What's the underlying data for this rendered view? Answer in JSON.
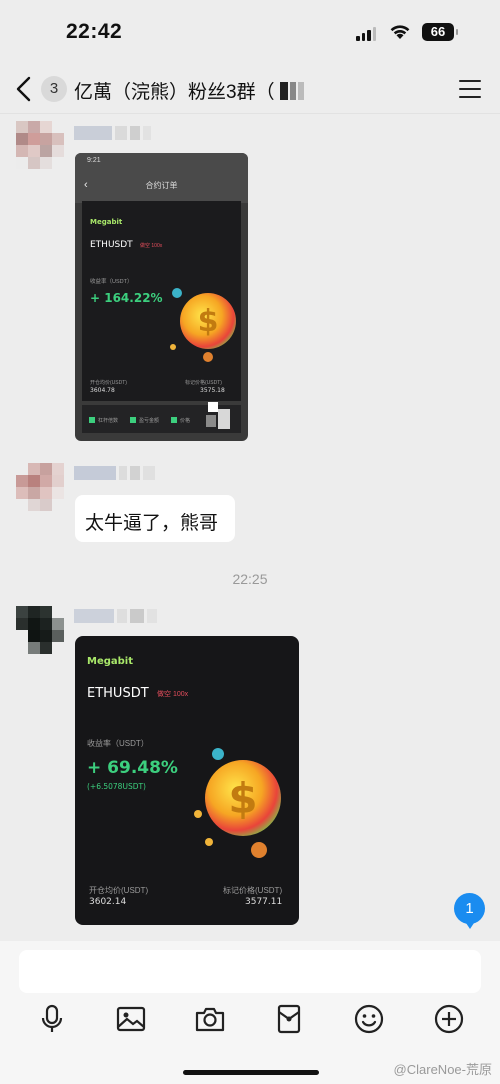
{
  "status_bar": {
    "time": "22:42",
    "battery": "66"
  },
  "header": {
    "unread_count": "3",
    "title": "亿萬（浣熊）粉丝3群（"
  },
  "messages": [
    {
      "kind": "image",
      "screenshot": {
        "status_time": "9:21",
        "page_title": "合约订单",
        "brand": "Megabit",
        "pair": "ETHUSDT",
        "leverage": "做空 100x",
        "yield_label": "收益率（USDT）",
        "yield": "+ 164.22%",
        "open_price_label": "开仓均价(USDT)",
        "open_price": "3604.78",
        "mark_price_label": "标记价格(USDT)",
        "mark_price": "3575.18",
        "options": [
          "杠杆倍数",
          "盈亏金额",
          "价格"
        ]
      }
    },
    {
      "kind": "text",
      "text": "太牛逼了，熊哥"
    },
    {
      "kind": "time",
      "text": "22:25"
    },
    {
      "kind": "image",
      "card": {
        "brand": "Megabit",
        "pair": "ETHUSDT",
        "leverage": "做空 100x",
        "yield_label": "收益率（USDT）",
        "yield": "+ 69.48%",
        "pnl": "(+6.5078USDT)",
        "open_price_label": "开仓均价(USDT)",
        "open_price": "3602.14",
        "mark_price_label": "标记价格(USDT)",
        "mark_price": "3577.11"
      }
    }
  ],
  "new_message_badge": "1",
  "toolbar": [
    "microphone-icon",
    "image-icon",
    "camera-icon",
    "red-packet-icon",
    "emoji-icon",
    "plus-icon"
  ],
  "watermark": "@ClareNoe-荒原",
  "colors": {
    "accent_green": "#3ccf7e",
    "brand_green": "#a9e86a",
    "badge_blue": "#1a8cf0",
    "short_red": "#e44d5c"
  }
}
